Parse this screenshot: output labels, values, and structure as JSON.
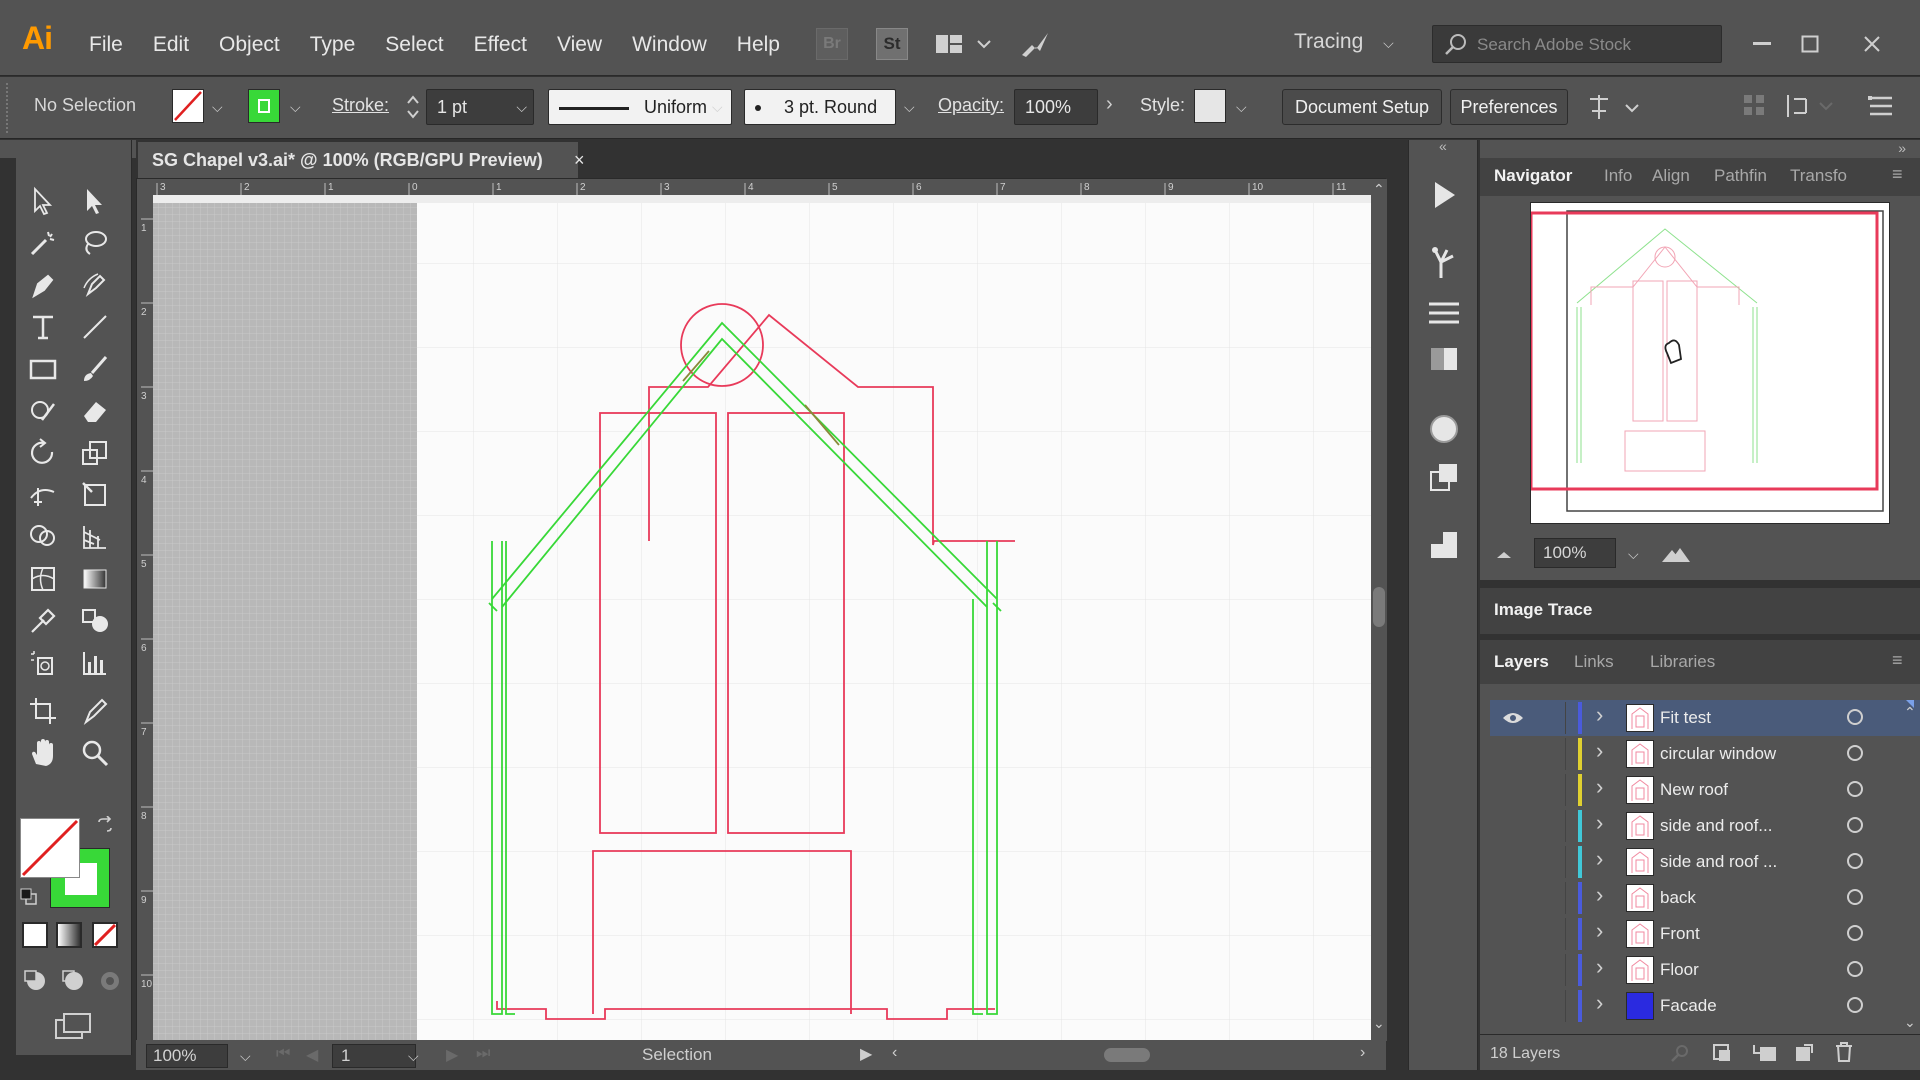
{
  "app": {
    "logo": "Ai",
    "menus": [
      "File",
      "Edit",
      "Object",
      "Type",
      "Select",
      "Effect",
      "View",
      "Window",
      "Help"
    ],
    "bridge_icon": "Br",
    "stock_icon": "St",
    "workspace": "Tracing",
    "search_placeholder": "Search Adobe Stock"
  },
  "control": {
    "selection": "No Selection",
    "stroke_label": "Stroke:",
    "stroke_value": "1 pt",
    "profile": "Uniform",
    "brush": "3 pt. Round",
    "opacity_label": "Opacity:",
    "opacity_value": "100%",
    "style_label": "Style:",
    "document_setup": "Document Setup",
    "preferences": "Preferences"
  },
  "document": {
    "tab_title": "SG Chapel v3.ai* @ 100% (RGB/GPU Preview)",
    "close": "×",
    "ruler_top": [
      "3",
      "2",
      "1",
      "0",
      "1",
      "2",
      "3",
      "4",
      "5",
      "6",
      "7",
      "8",
      "9",
      "10",
      "11"
    ],
    "ruler_left": [
      "1",
      "2",
      "3",
      "4",
      "5",
      "6",
      "7",
      "8",
      "9",
      "10"
    ]
  },
  "status": {
    "zoom": "100%",
    "artboard": "1",
    "tool": "Selection"
  },
  "navigator": {
    "tabs": [
      "Navigator",
      "Info",
      "Align",
      "Pathfin",
      "Transfo"
    ],
    "zoom": "100%"
  },
  "image_trace": {
    "title": "Image Trace"
  },
  "layers_panel": {
    "tabs": [
      "Layers",
      "Links",
      "Libraries"
    ],
    "count": "18 Layers",
    "layers": [
      {
        "name": "Fit test",
        "color": "#4a5bdc",
        "selected": true,
        "visible": true
      },
      {
        "name": "circular window",
        "color": "#e0d030",
        "selected": false,
        "visible": false
      },
      {
        "name": "New roof",
        "color": "#e0d030",
        "selected": false,
        "visible": false
      },
      {
        "name": "side and roof...",
        "color": "#40c8d8",
        "selected": false,
        "visible": false
      },
      {
        "name": "side and roof ...",
        "color": "#40c8d8",
        "selected": false,
        "visible": false
      },
      {
        "name": "back",
        "color": "#4a5bdc",
        "selected": false,
        "visible": false
      },
      {
        "name": "Front",
        "color": "#4a5bdc",
        "selected": false,
        "visible": false
      },
      {
        "name": "Floor",
        "color": "#4a5bdc",
        "selected": false,
        "visible": false
      },
      {
        "name": "Facade",
        "color": "#4a5bdc",
        "selected": false,
        "visible": false
      }
    ]
  },
  "colors": {
    "accent_pink": "#e83a5a",
    "accent_green": "#38d838",
    "panel": "#535353",
    "selected_row": "#4a5b7a"
  }
}
